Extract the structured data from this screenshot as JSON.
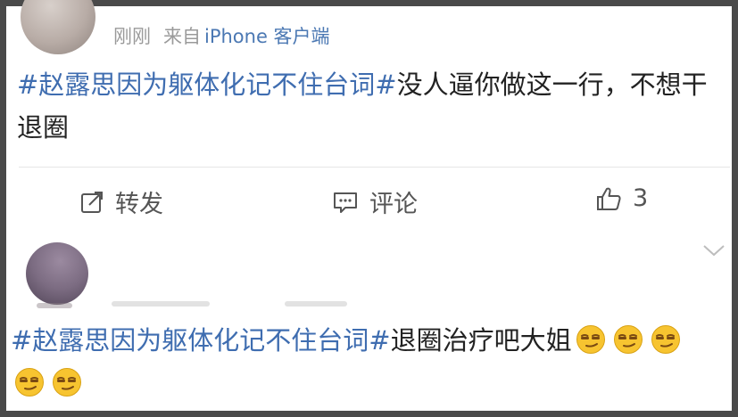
{
  "post_a": {
    "time": "刚刚",
    "source_prefix": "来自",
    "device": "iPhone 客户端",
    "hashtag": "#赵露思因为躯体化记不住台词#",
    "text": "没人逼你做这一行，不想干退圈"
  },
  "actions": {
    "repost_label": "转发",
    "comment_label": "评论",
    "like_count": "3"
  },
  "post_b": {
    "hashtag": "#赵露思因为躯体化记不住台词#",
    "text": "退圈治疗吧大姐",
    "emoji_name": "smirk-emoji",
    "emoji_count": 5
  },
  "colors": {
    "link": "#3f6db0",
    "text": "#222222",
    "muted": "#9a9a9a",
    "frame": "#4a4a4a"
  }
}
